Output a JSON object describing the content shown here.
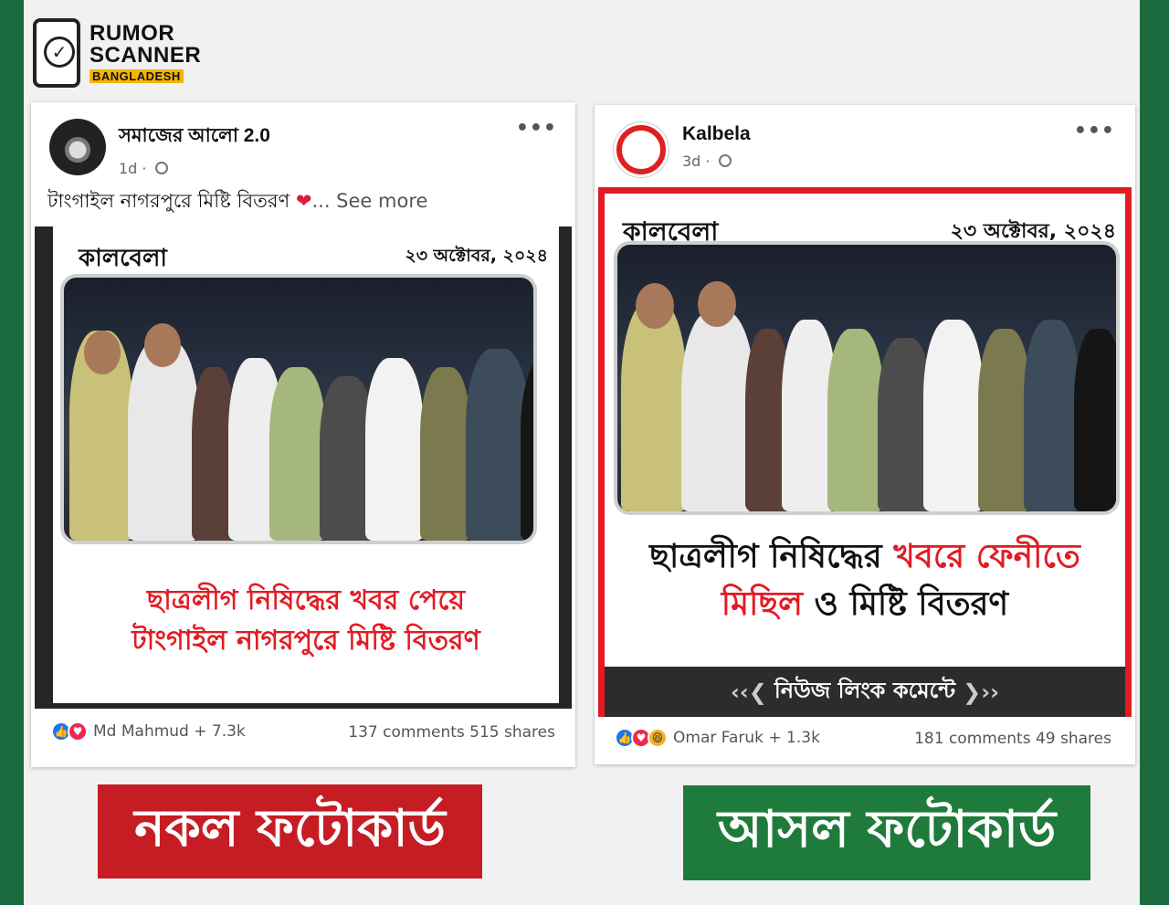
{
  "logo": {
    "line1": "RUMOR",
    "line2": "SCANNER",
    "line3": "BANGLADESH"
  },
  "left_post": {
    "page_name": "সমাজের আলো 2.0",
    "time": "1d ·",
    "more": "•••",
    "caption": "টাংগাইল নাগরপুরে মিষ্টি বিতরণ ",
    "heart": "❤",
    "see_more": "... See more",
    "card": {
      "brand": "কালবেলা",
      "date": "২৩ অক্টোবর, ২০২৪",
      "headline_line1": "ছাত্রলীগ নিষিদ্ধের খবর পেয়ে",
      "headline_line2": "টাংগাইল নাগরপুরে মিষ্টি বিতরণ"
    },
    "reactors": "Md Mahmud + 7.3k",
    "stats": "137 comments  515 shares"
  },
  "right_post": {
    "page_name": "Kalbela",
    "time": "3d ·",
    "more": "•••",
    "card": {
      "brand": "কালবেলা",
      "date": "২৩ অক্টোবর, ২০২৪",
      "headline_line1_a": "ছাত্রলীগ নিষিদ্ধের ",
      "headline_line1_b": "খবরে ফেনীতে",
      "headline_line2_a": "মিছিল",
      "headline_line2_b": " ও মিষ্টি বিতরণ",
      "cta": "নিউজ লিংক কমেন্টে"
    },
    "reactors": "Omar Faruk + 1.3k",
    "stats": "181 comments  49 shares"
  },
  "labels": {
    "fake": "নকল ফটোকার্ড",
    "real": "আসল ফটোকার্ড"
  },
  "colors": {
    "fake_label": "#c51d23",
    "real_label": "#1e7b3b",
    "frame": "#1b6b3e",
    "brand_red": "#e31b23"
  }
}
